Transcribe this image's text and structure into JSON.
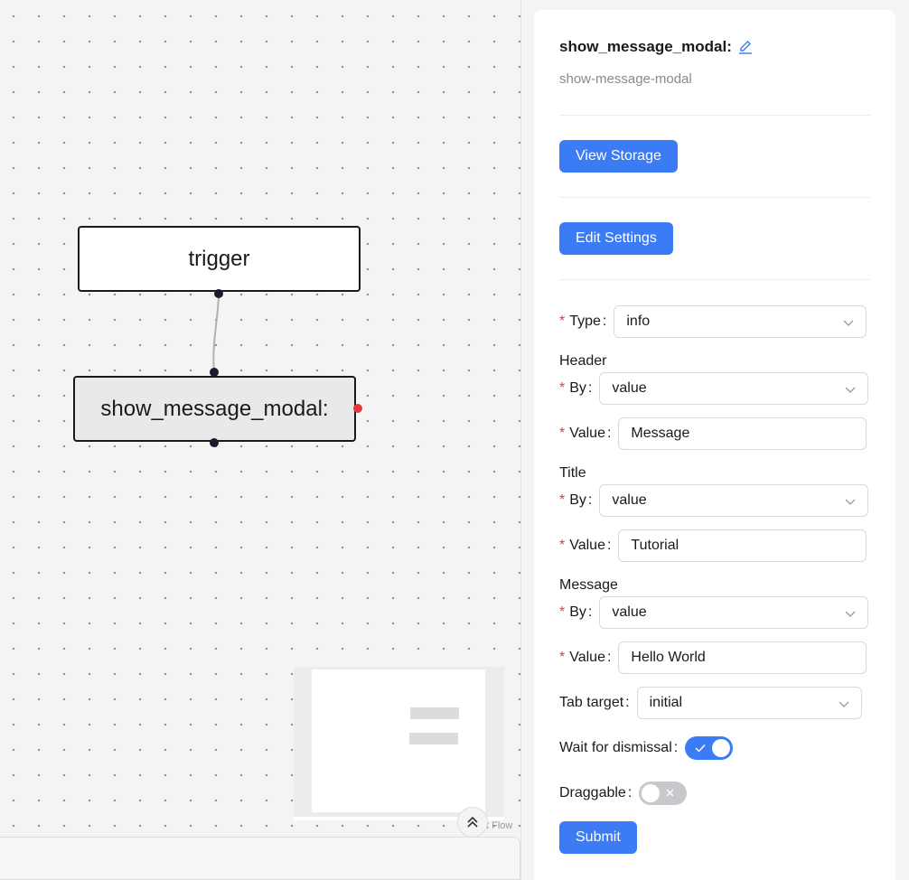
{
  "canvas": {
    "nodes": [
      {
        "label": "trigger"
      },
      {
        "label": "show_message_modal:"
      }
    ],
    "attribution": "t Flow"
  },
  "panel": {
    "node_name": "show_message_modal:",
    "node_id": "show-message-modal",
    "view_storage_label": "View Storage",
    "edit_settings_label": "Edit Settings",
    "submit_label": "Submit",
    "form": {
      "type_label": "Type",
      "type_value": "info",
      "header_section": "Header",
      "header_by_label": "By",
      "header_by_value": "value",
      "header_value_label": "Value",
      "header_value": "Message",
      "title_section": "Title",
      "title_by_label": "By",
      "title_by_value": "value",
      "title_value_label": "Value",
      "title_value": "Tutorial",
      "message_section": "Message",
      "message_by_label": "By",
      "message_by_value": "value",
      "message_value_label": "Value",
      "message_value": "Hello World",
      "tab_target_label": "Tab target",
      "tab_target_value": "initial",
      "wait_label": "Wait for dismissal",
      "wait_on": true,
      "draggable_label": "Draggable",
      "draggable_on": false
    }
  },
  "colors": {
    "accent": "#3b7cf5",
    "required": "#e53935",
    "handle_error": "#e53935"
  }
}
